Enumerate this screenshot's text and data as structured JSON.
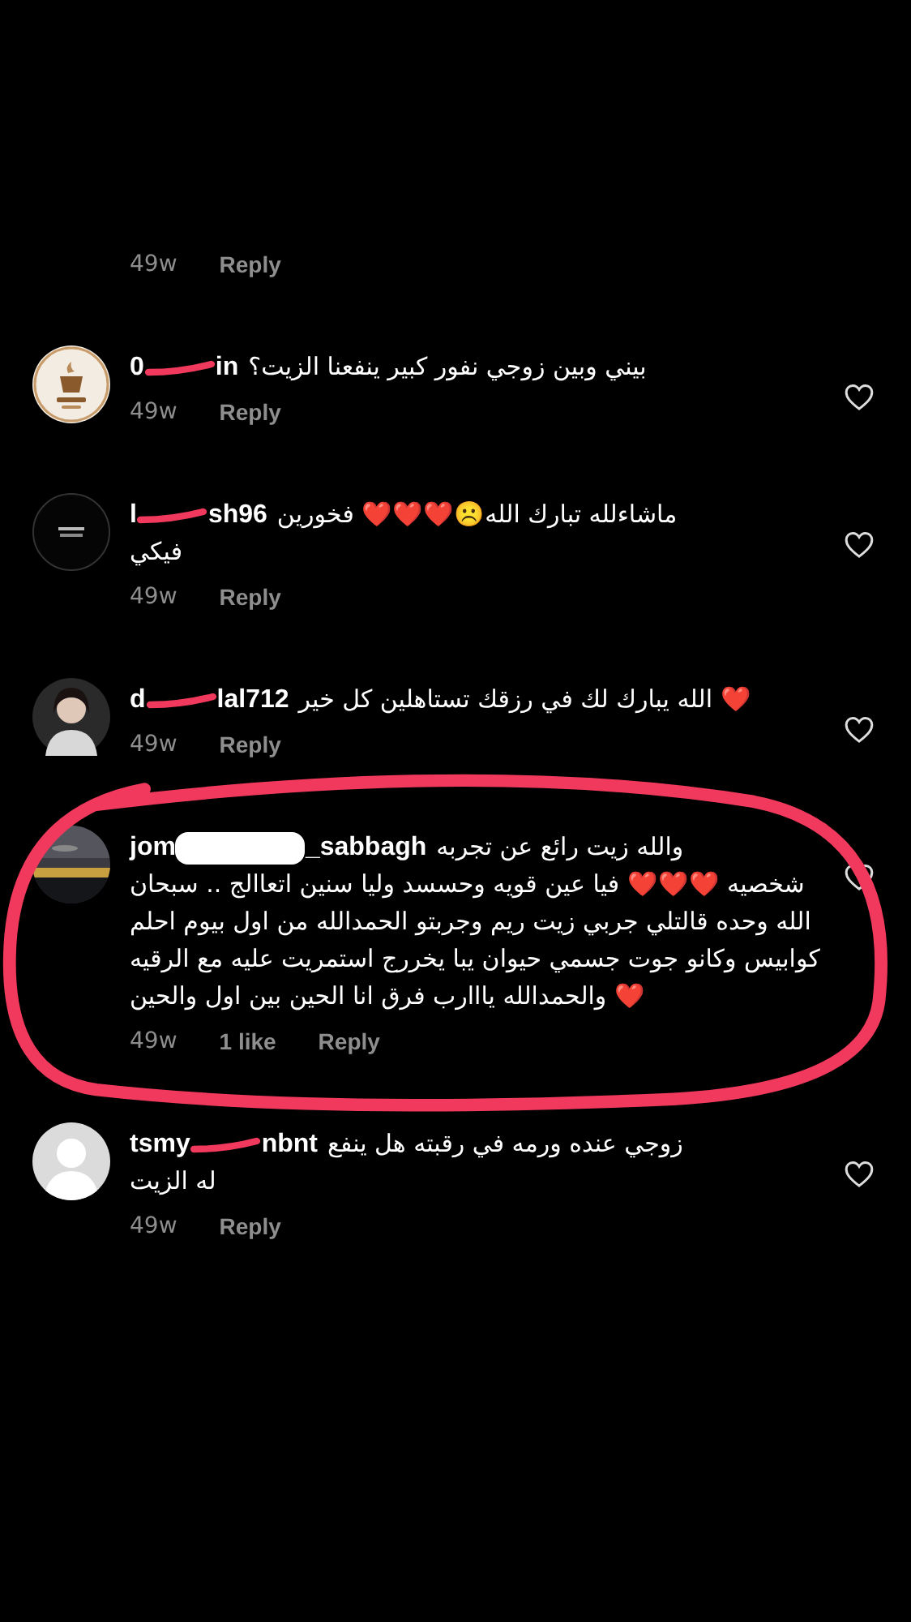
{
  "comments": [
    {
      "kind": "meta_only",
      "time": "49w",
      "reply": "Reply"
    },
    {
      "kind": "comment",
      "avatar": {
        "kind": "cup"
      },
      "username_start": "0",
      "redaction": {
        "kind": "red-stroke"
      },
      "username_end": "in",
      "text": "بيني وبين زوجي نفور كبير ينفعنا الزيت؟",
      "time": "49w",
      "reply": "Reply",
      "liked": false
    },
    {
      "kind": "comment",
      "avatar": {
        "kind": "dark"
      },
      "username_start": "l",
      "redaction": {
        "kind": "red-stroke"
      },
      "username_end": "sh96",
      "text": "ماشاءلله تبارك الله☹️❤️❤️❤️ فخورين",
      "text_more": "فيكي",
      "time": "49w",
      "reply": "Reply",
      "liked": false
    },
    {
      "kind": "comment",
      "avatar": {
        "kind": "person"
      },
      "username_start": "d",
      "redaction": {
        "kind": "red-stroke"
      },
      "username_end": "lal712",
      "text": "الله يبارك لك في رزقك تستاهلين كل خير ❤️",
      "time": "49w",
      "reply": "Reply",
      "liked": false
    },
    {
      "kind": "comment",
      "avatar": {
        "kind": "landscape"
      },
      "username_start": "jom",
      "redaction": {
        "kind": "white-blot"
      },
      "username_end": "_sabbagh",
      "circled": true,
      "text": "والله زيت رائع عن تجربه",
      "text_more": "شخصيه ❤️❤️❤️ فيا عين قويه وحسسد وليا سنين اتعاالج .. سبحان الله وحده قالتلي جربي زيت ريم وجربتو الحمدالله من اول بيوم احلم كوابيس وكانو جوت جسمي حيوان يبا يخررج استمريت عليه مع الرقيه والحمدالله يااارب فرق انا الحين بين اول والحين ❤️",
      "time": "49w",
      "likes": "1 like",
      "reply": "Reply",
      "liked": false
    },
    {
      "kind": "comment",
      "avatar": {
        "kind": "default"
      },
      "username_start": "tsmy",
      "redaction": {
        "kind": "red-stroke"
      },
      "username_end": "nbnt",
      "text": "زوجي عنده ورمه في رقبته هل ينفع",
      "text_more": "له الزيت",
      "time": "49w",
      "reply": "Reply",
      "liked": false
    }
  ]
}
